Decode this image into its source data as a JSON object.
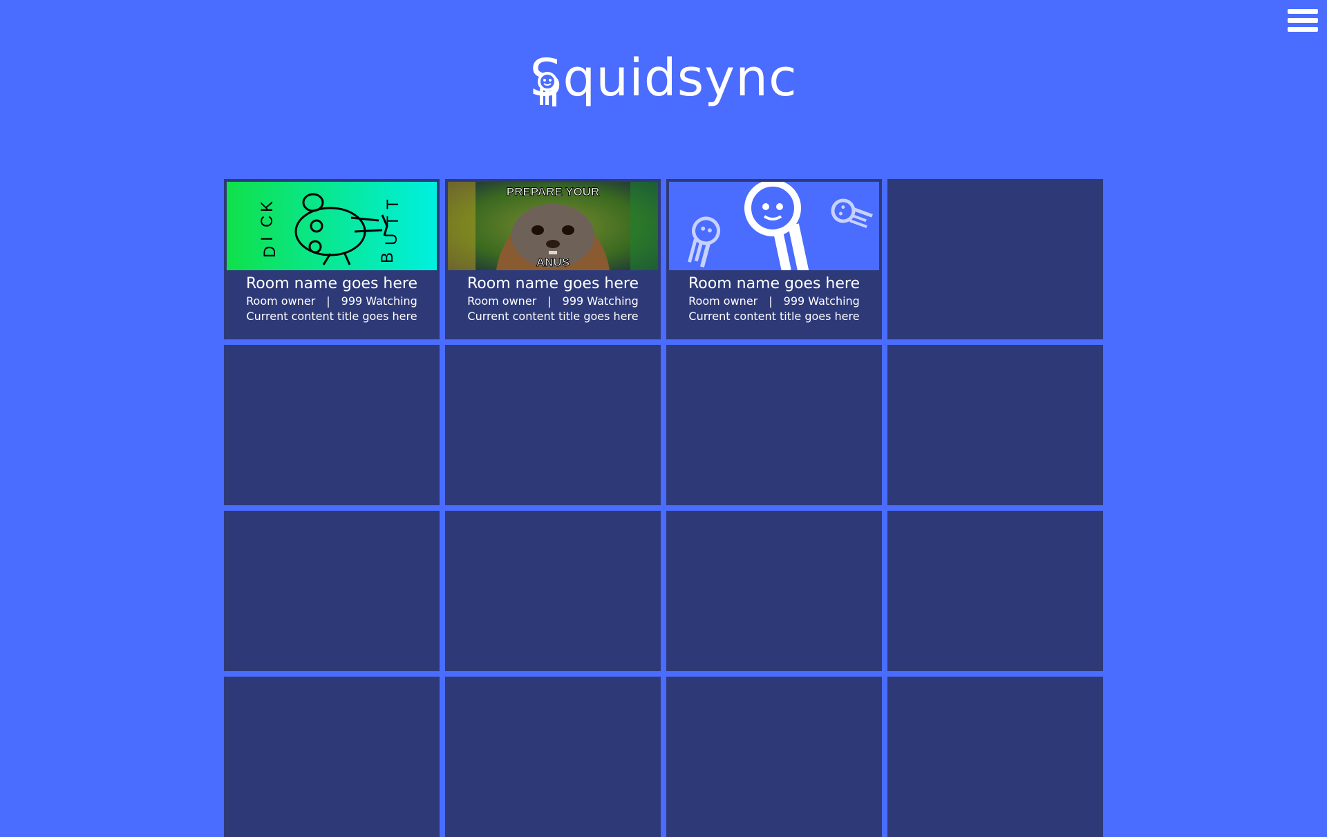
{
  "app": {
    "title": "Squidsync",
    "menu_icon": "hamburger-menu-icon",
    "background_color": "#4a6cff",
    "card_color": "#2e3a78"
  },
  "rooms": [
    {
      "name": "Room name goes here",
      "owner": "Room owner",
      "separator": "|",
      "watching": "999 Watching",
      "content_title": "Current content title goes here",
      "thumbnail_text": [
        "D",
        "I",
        "C",
        "K",
        "B",
        "U",
        "T",
        "T"
      ]
    },
    {
      "name": "Room name goes here",
      "owner": "Room owner",
      "separator": "|",
      "watching": "999 Watching",
      "content_title": "Current content title goes here",
      "thumbnail_text": [
        "PREPARE YOUR",
        "ANUS"
      ]
    },
    {
      "name": "Room name goes here",
      "owner": "Room owner",
      "separator": "|",
      "watching": "999 Watching",
      "content_title": "Current content title goes here",
      "thumbnail_icon": "squid-mascot-icon"
    }
  ],
  "empty_slots": 13
}
